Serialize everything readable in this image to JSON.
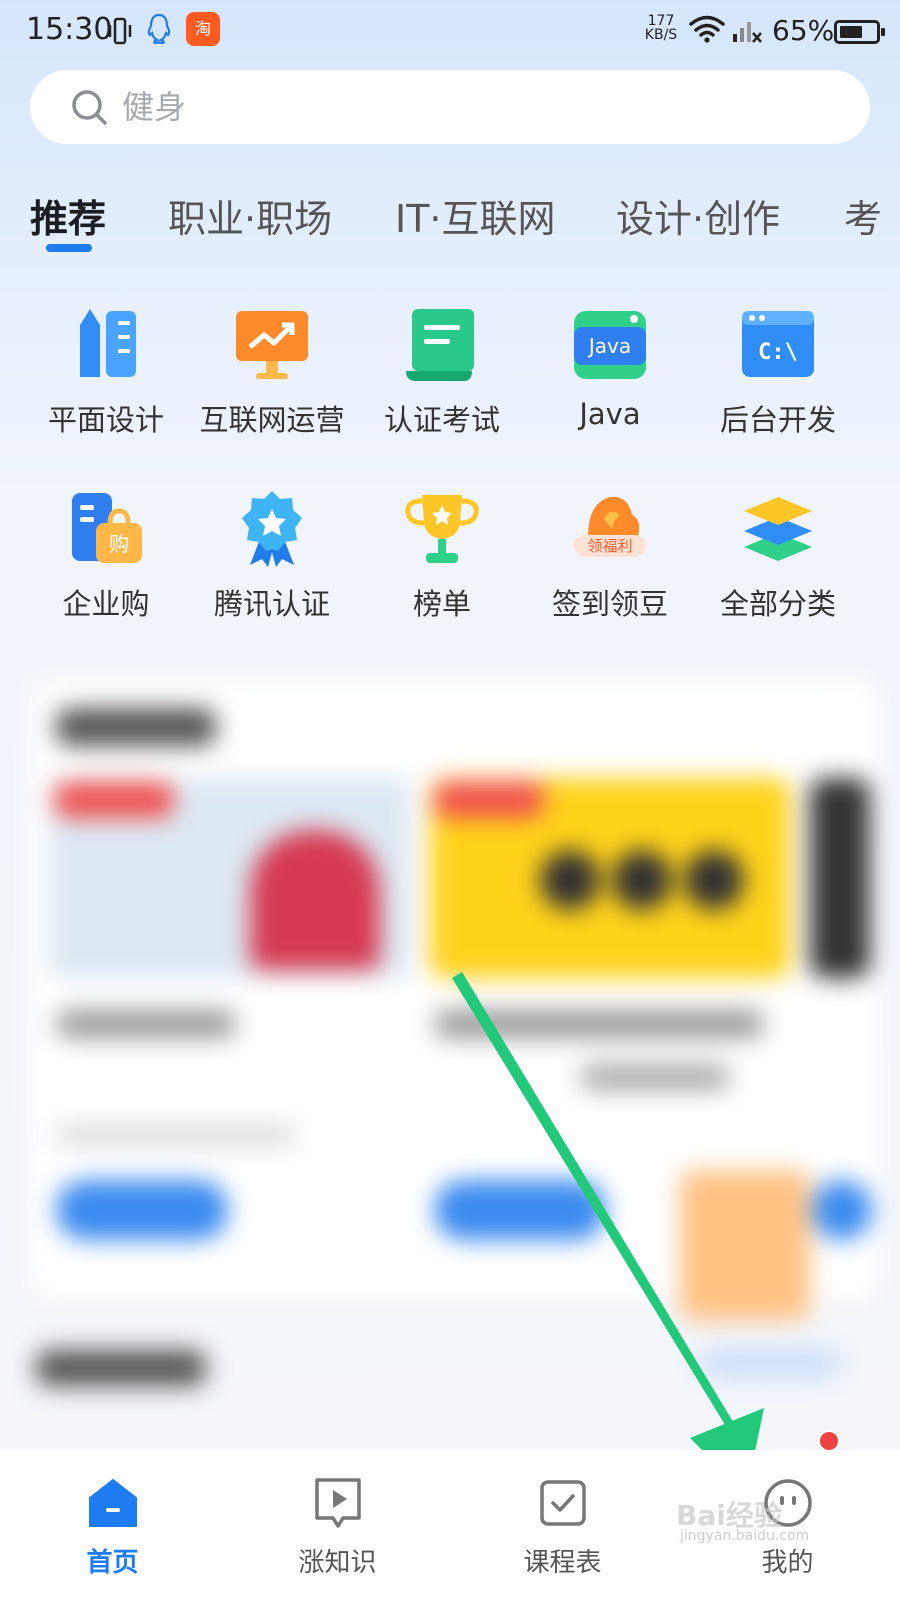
{
  "status_bar": {
    "time": "15:30",
    "taobao_label": "淘",
    "net_speed_value": "177",
    "net_speed_unit": "KB/S",
    "battery": "65%",
    "battery_level": 0.65
  },
  "search": {
    "placeholder": "健身"
  },
  "tabs": [
    {
      "label": "推荐",
      "active": true
    },
    {
      "label": "职业·职场",
      "active": false
    },
    {
      "label": "IT·互联网",
      "active": false
    },
    {
      "label": "设计·创作",
      "active": false
    },
    {
      "label": "考",
      "active": false
    }
  ],
  "categories": [
    {
      "label": "平面设计",
      "icon": "ruler-pencil-icon"
    },
    {
      "label": "互联网运营",
      "icon": "monitor-chart-icon"
    },
    {
      "label": "认证考试",
      "icon": "certificate-scroll-icon"
    },
    {
      "label": "Java",
      "icon": "java-icon",
      "icon_text": "Java"
    },
    {
      "label": "后台开发",
      "icon": "terminal-icon",
      "icon_text": "C:\\"
    },
    {
      "label": "企业购",
      "icon": "shopping-bag-icon",
      "icon_text": "购"
    },
    {
      "label": "腾讯认证",
      "icon": "badge-ribbon-icon"
    },
    {
      "label": "榜单",
      "icon": "trophy-icon"
    },
    {
      "label": "签到领豆",
      "icon": "welfare-icon",
      "icon_text": "领福利"
    },
    {
      "label": "全部分类",
      "icon": "layers-icon"
    }
  ],
  "bottom_nav": [
    {
      "label": "首页",
      "icon": "home-icon",
      "active": true
    },
    {
      "label": "涨知识",
      "icon": "play-video-icon",
      "active": false
    },
    {
      "label": "课程表",
      "icon": "checklist-icon",
      "active": false
    },
    {
      "label": "我的",
      "icon": "profile-face-icon",
      "active": false
    }
  ],
  "watermark": {
    "brand": "Bai经验",
    "url": "jingyan.baidu.com"
  },
  "colors": {
    "accent": "#1d7cf2",
    "annotation_arrow": "#22c97a",
    "badge": "#f04040"
  }
}
